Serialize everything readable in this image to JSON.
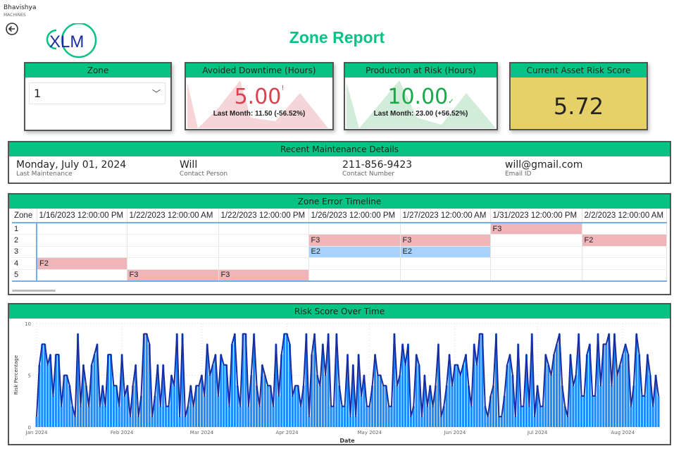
{
  "header": {
    "brand": "Bhavishya",
    "brand_sub": "MACHINES",
    "logo_text": "XLM",
    "title": "Zone Report"
  },
  "zone_slicer": {
    "title": "Zone",
    "value": "1"
  },
  "kpis": [
    {
      "title": "Avoided Downtime (Hours)",
      "value": "5.00",
      "indicator": "!",
      "last_month": "Last Month: 11.50 (-56.52%)",
      "color": "#d9434f"
    },
    {
      "title": "Production at Risk (Hours)",
      "value": "10.00",
      "indicator": "✓",
      "last_month": "Last Month: 23.00 (+56.52%)",
      "color": "#1aa84a"
    }
  ],
  "risk_score": {
    "title": "Current Asset Risk Score",
    "value": "5.72",
    "bg": "#e6d068"
  },
  "maintenance": {
    "title": "Recent Maintenance Details",
    "items": [
      {
        "value": "Monday, July 01, 2024",
        "label": "Last Maintenance"
      },
      {
        "value": "Will",
        "label": "Contact Person"
      },
      {
        "value": "211-856-9423",
        "label": "Contact Number"
      },
      {
        "value": "will@gmail.com",
        "label": "Email ID"
      }
    ]
  },
  "timeline": {
    "title": "Zone Error Timeline",
    "zone_header": "Zone",
    "columns": [
      "1/16/2023 12:00:00 PM",
      "1/22/2023 12:00:00 AM",
      "1/22/2023 12:00:00 PM",
      "1/26/2023 12:00:00 PM",
      "1/27/2023 12:00:00 AM",
      "1/31/2023 12:00:00 PM",
      "2/2/2023 12:00:00 AM"
    ],
    "rows": [
      {
        "zone": "1",
        "cells": [
          "",
          "",
          "",
          "",
          "",
          "F3",
          ""
        ]
      },
      {
        "zone": "2",
        "cells": [
          "",
          "",
          "",
          "F3",
          "F3",
          "",
          "F2"
        ]
      },
      {
        "zone": "3",
        "cells": [
          "",
          "",
          "",
          "E2",
          "E2",
          "",
          ""
        ]
      },
      {
        "zone": "4",
        "cells": [
          "F2",
          "",
          "",
          "",
          "",
          "",
          ""
        ]
      },
      {
        "zone": "5",
        "cells": [
          "",
          "F3",
          "F3",
          "",
          "",
          "",
          ""
        ]
      }
    ]
  },
  "chart_data": {
    "type": "area",
    "title": "Risk Score Over Time",
    "xlabel": "Date",
    "ylabel": "Risk Percentage",
    "ylim": [
      0,
      10
    ],
    "yticks": [
      "0",
      "5",
      "10"
    ],
    "start_date": "2024-01-01",
    "xticks": [
      "Jan 2024",
      "Feb 2024",
      "Mar 2024",
      "Apr 2024",
      "May 2024",
      "Jun 2024",
      "Jul 2024",
      "Aug 2024"
    ],
    "values": [
      1,
      6,
      8,
      8,
      6,
      7,
      3,
      7,
      7,
      2,
      5,
      5,
      4,
      2,
      1,
      9,
      2,
      6,
      4,
      2,
      6,
      7,
      8,
      2,
      4,
      2,
      7,
      7,
      4,
      4,
      2,
      7,
      3,
      4,
      1,
      4,
      6,
      1,
      3,
      9,
      9,
      8,
      1,
      3,
      6,
      2,
      6,
      2,
      2,
      5,
      4,
      9,
      1,
      9,
      1,
      2,
      4,
      2,
      4,
      4,
      5,
      3,
      8,
      5,
      6,
      7,
      3,
      7,
      6,
      6,
      2,
      8,
      9,
      4,
      2,
      9,
      9,
      2,
      5,
      9,
      4,
      2,
      6,
      5,
      4,
      4,
      2,
      8,
      3,
      7,
      9,
      9,
      8,
      3,
      4,
      4,
      2,
      4,
      9,
      1,
      7,
      9,
      5,
      4,
      8,
      5,
      9,
      2,
      2,
      9,
      4,
      2,
      2,
      7,
      1,
      6,
      1,
      7,
      3,
      5,
      2,
      2,
      4,
      7,
      5,
      5,
      4,
      4,
      2,
      2,
      9,
      4,
      5,
      8,
      6,
      8,
      1,
      2,
      7,
      6,
      1,
      5,
      2,
      4,
      2,
      4,
      8,
      1,
      2,
      4,
      7,
      4,
      6,
      6,
      5,
      6,
      7,
      4,
      2,
      8,
      6,
      9,
      9,
      2,
      1,
      3,
      4,
      9,
      1,
      1,
      3,
      6,
      7,
      5,
      1,
      8,
      2,
      2,
      7,
      2,
      9,
      1,
      4,
      2,
      2,
      7,
      6,
      5,
      7,
      8,
      9,
      4,
      2,
      1,
      7,
      4,
      5,
      9,
      3,
      3,
      7,
      8,
      3,
      3,
      9,
      4,
      8,
      8,
      9,
      4,
      9,
      5,
      6,
      7,
      8,
      7,
      2,
      4,
      9,
      7,
      3,
      3,
      7,
      5,
      2,
      5,
      3
    ],
    "bar_color": "#1a8cff",
    "line_color": "#1a2c9e",
    "grid": true
  }
}
